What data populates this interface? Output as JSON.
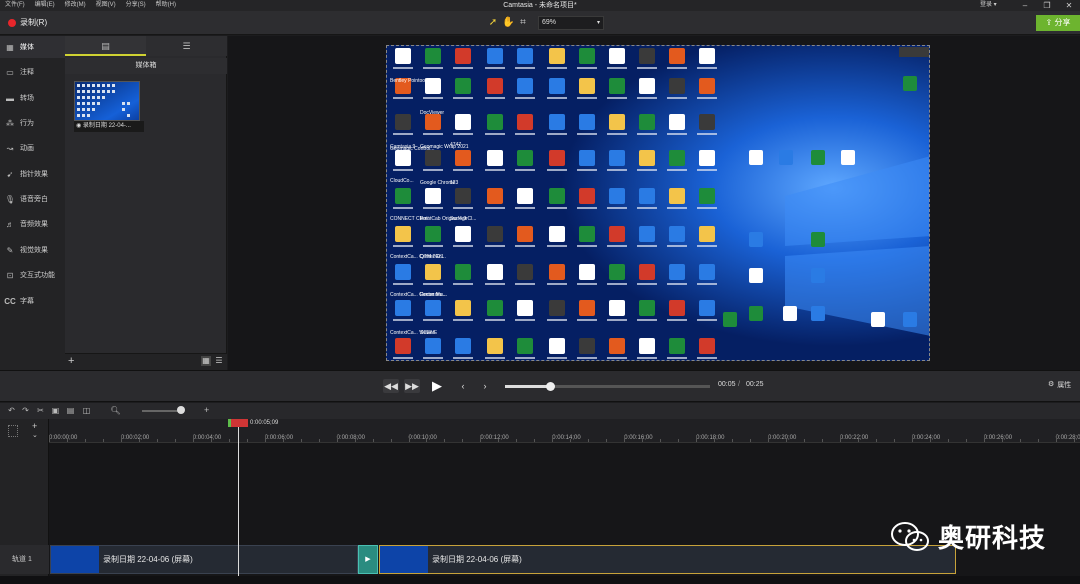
{
  "menubar": {
    "items": [
      "文件(F)",
      "编辑(E)",
      "修改(M)",
      "视图(V)",
      "分享(S)",
      "帮助(H)"
    ],
    "title": "Camtasia - 未命名项目*",
    "login": "登录 ▾"
  },
  "toolbar": {
    "record_label": "录制(R)",
    "zoom_value": "69%",
    "share_label": "分享",
    "colors": {
      "record": "#e8262b",
      "share": "#6db42f"
    }
  },
  "sidebar": {
    "items": [
      {
        "label": "媒体",
        "icon": "film-icon",
        "active": true
      },
      {
        "label": "注释",
        "icon": "annotation-icon"
      },
      {
        "label": "转场",
        "icon": "transition-icon"
      },
      {
        "label": "行为",
        "icon": "behavior-icon"
      },
      {
        "label": "动画",
        "icon": "animation-icon"
      },
      {
        "label": "指针效果",
        "icon": "cursor-icon"
      },
      {
        "label": "语音旁白",
        "icon": "microphone-icon"
      },
      {
        "label": "音频效果",
        "icon": "audio-icon"
      },
      {
        "label": "视觉效果",
        "icon": "visual-effect-icon"
      },
      {
        "label": "交互式功能",
        "icon": "interactive-icon"
      },
      {
        "label": "字幕",
        "icon": "cc-icon"
      }
    ]
  },
  "media_bin": {
    "title": "媒体箱",
    "item_label": "录制日期 22-04-..."
  },
  "canvas": {
    "desktop_icons": [
      {
        "label": "Bentley Pointools"
      },
      {
        "label": "DocViewer"
      },
      {
        "label": "4747"
      },
      {
        "label": "Geomagic Control..."
      },
      {
        "label": "Camtasia 9"
      },
      {
        "label": "Geomagic Wrap 2021"
      },
      {
        "label": "CloudCo..."
      },
      {
        "label": "Google Chrome"
      },
      {
        "label": "123"
      },
      {
        "label": "CONNECT Client"
      },
      {
        "label": "PointCab Origins 4.0"
      },
      {
        "label": "SurfogirCl..."
      },
      {
        "label": "ContextCa... Center En..."
      },
      {
        "label": "QTM 2021"
      },
      {
        "label": "ContextCa... Center Ma..."
      },
      {
        "label": "Reconstru..."
      },
      {
        "label": "ContextCa... Viewer"
      },
      {
        "label": "SCENE"
      }
    ]
  },
  "playback": {
    "current": "00:05",
    "separator": "/",
    "total": "00:25",
    "props_label": "属性"
  },
  "timeline": {
    "playhead": "0:00:05;09",
    "ticks": [
      "0:00:00;00",
      "0:00:02;00",
      "0:00:04;00",
      "0:00:06;00",
      "0:00:08;00",
      "0:00:10;00",
      "0:00:12;00",
      "0:00:14;00",
      "0:00:16;00",
      "0:00:18;00",
      "0:00:20;00",
      "0:00:22;00",
      "0:00:24;00",
      "0:00:26;00",
      "0:00:28;00"
    ],
    "track_label": "轨道 1",
    "clips": [
      {
        "label": "录制日期 22-04-06 (屏幕)"
      },
      {
        "label": "录制日期 22-04-06 (屏幕)"
      }
    ]
  },
  "watermark": {
    "text": "奥研科技"
  }
}
